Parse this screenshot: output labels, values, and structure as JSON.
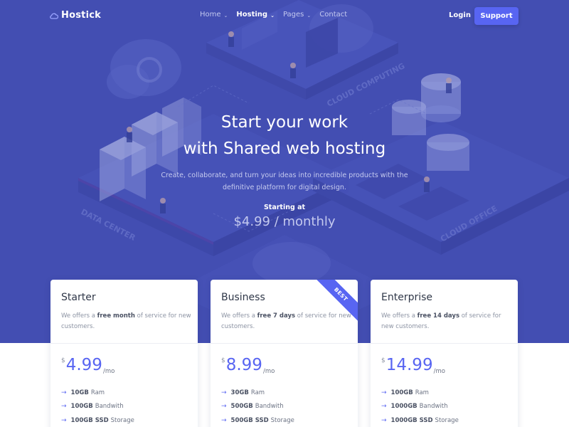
{
  "brand": {
    "name": "Hostick",
    "icon": "cloud-icon"
  },
  "nav": {
    "items": [
      {
        "label": "Home",
        "dropdown": true,
        "active": false
      },
      {
        "label": "Hosting",
        "dropdown": true,
        "active": true
      },
      {
        "label": "Pages",
        "dropdown": true,
        "active": false
      },
      {
        "label": "Contact",
        "dropdown": false,
        "active": false
      }
    ],
    "login_label": "Login",
    "support_label": "Support"
  },
  "hero": {
    "title_line1": "Start your work",
    "title_line2": "with Shared web hosting",
    "subtitle_line1": "Create, collaborate, and turn your ideas into incredible products with the",
    "subtitle_line2": "definitive platform for digital design.",
    "starting_label": "Starting at",
    "price": "$4.99 / monthly",
    "illustration_labels": [
      "CLOUD COMPUTING",
      "DATA CENTER",
      "CLOUD OFFICE"
    ]
  },
  "plans": [
    {
      "name": "Starter",
      "desc_prefix": "We offers a ",
      "desc_highlight": "free month",
      "desc_suffix": " of service for new customers.",
      "currency": "$",
      "amount": "4.99",
      "period": "/mo",
      "ribbon": "",
      "features": [
        {
          "value": "10GB",
          "label": "Ram"
        },
        {
          "value": "100GB",
          "label": "Bandwith"
        },
        {
          "value": "100GB SSD",
          "label": "Storage"
        }
      ]
    },
    {
      "name": "Business",
      "desc_prefix": "We offers a ",
      "desc_highlight": "free 7 days",
      "desc_suffix": " of service for new customers.",
      "currency": "$",
      "amount": "8.99",
      "period": "/mo",
      "ribbon": "BEST",
      "features": [
        {
          "value": "30GB",
          "label": "Ram"
        },
        {
          "value": "500GB",
          "label": "Bandwith"
        },
        {
          "value": "500GB SSD",
          "label": "Storage"
        }
      ]
    },
    {
      "name": "Enterprise",
      "desc_prefix": "We offers a ",
      "desc_highlight": "free 14 days",
      "desc_suffix": " of service for new customers.",
      "currency": "$",
      "amount": "14.99",
      "period": "/mo",
      "ribbon": "",
      "features": [
        {
          "value": "100GB",
          "label": "Ram"
        },
        {
          "value": "1000GB",
          "label": "Bandwith"
        },
        {
          "value": "1000GB SSD",
          "label": "Storage"
        }
      ]
    }
  ],
  "colors": {
    "hero_bg": "#4550b4",
    "accent": "#5865f2",
    "text_dark": "#2f3748",
    "text_muted": "#8c93a3"
  }
}
